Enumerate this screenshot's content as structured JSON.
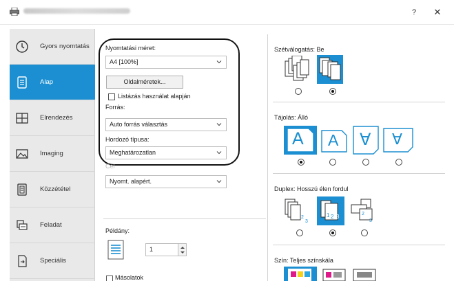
{
  "window": {
    "help_label": "?",
    "close_label": "✕"
  },
  "sidebar": {
    "items": [
      {
        "label": "Gyors nyomtatás",
        "icon": "clock-icon"
      },
      {
        "label": "Alap",
        "icon": "document-icon"
      },
      {
        "label": "Elrendezés",
        "icon": "layout-grid-icon"
      },
      {
        "label": "Imaging",
        "icon": "image-icon"
      },
      {
        "label": "Közzététel",
        "icon": "publishing-icon"
      },
      {
        "label": "Feladat",
        "icon": "job-icon"
      },
      {
        "label": "Speciális",
        "icon": "advanced-icon"
      }
    ],
    "active_index": 1,
    "active_color": "#1b8fd1"
  },
  "basic": {
    "print_size_label": "Nyomtatási méret:",
    "print_size_value": "A4 [100%]",
    "page_sizes_button": "Oldalméretek...",
    "list_based_label": "Listázás használat alapján",
    "source_label": "Forrás:",
    "source_value": "Auto forrás választás",
    "media_type_label": "Hordozó típusa:",
    "media_type_value": "Meghatározatlan",
    "destination_partial_label": "Cél",
    "destination_value": "Nyomt. alapért.",
    "copies_label": "Példány:",
    "copies_value": "1",
    "copies_partial_label": "Másolatok"
  },
  "right": {
    "collate_label": "Szétválogatás:  Be",
    "orientation_label": "Tájolás:  Álló",
    "orientation_glyphs": [
      "A",
      "A",
      "∀",
      "∀"
    ],
    "duplex_label": "Duplex:  Hosszú élen fordul",
    "color_label": "Szín:  Teljes színskála"
  }
}
